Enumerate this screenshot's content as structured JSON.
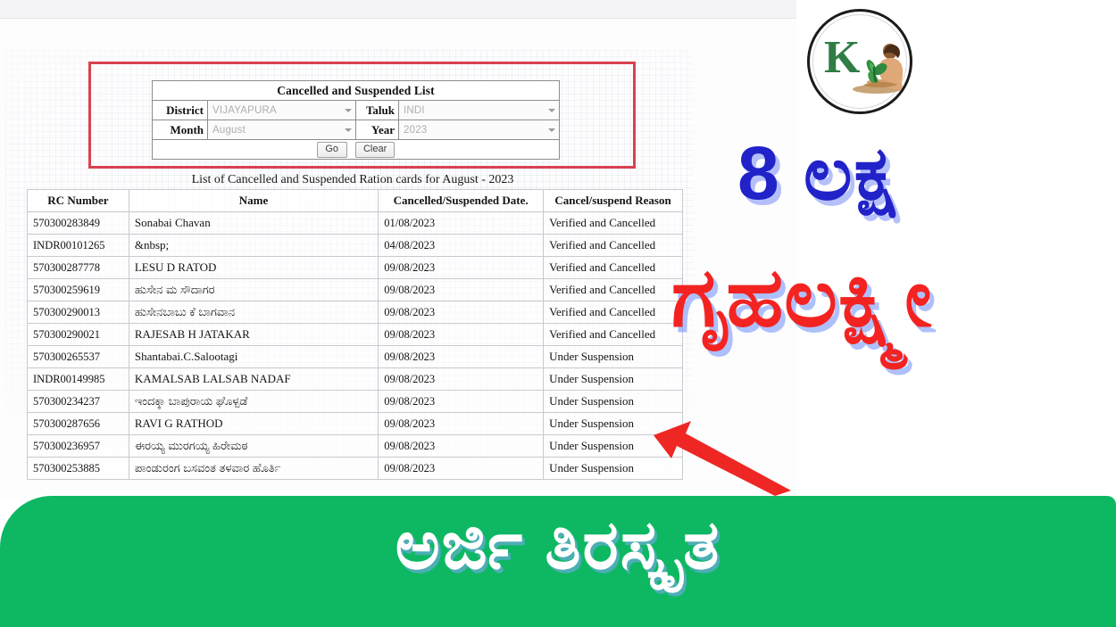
{
  "logo": {
    "letter": "K",
    "icon": "farmer-with-plant-icon"
  },
  "filter_form": {
    "title": "Cancelled and Suspended List",
    "fields": {
      "district_label": "District",
      "district_value": "VIJAYAPURA",
      "taluk_label": "Taluk",
      "taluk_value": "INDI",
      "month_label": "Month",
      "month_value": "August",
      "year_label": "Year",
      "year_value": "2023"
    },
    "buttons": {
      "go": "Go",
      "clear": "Clear"
    }
  },
  "results": {
    "caption": "List of Cancelled and Suspended Ration cards for August - 2023",
    "columns": {
      "rc": "RC Number",
      "name": "Name",
      "date": "Cancelled/Suspended Date.",
      "reason": "Cancel/suspend Reason"
    },
    "rows": [
      {
        "rc": "570300283849",
        "name": "Sonabai Chavan",
        "kannada": false,
        "date": "01/08/2023",
        "reason": "Verified and Cancelled"
      },
      {
        "rc": "INDR00101265",
        "name": "&nbsp;",
        "kannada": false,
        "date": "04/08/2023",
        "reason": "Verified and Cancelled"
      },
      {
        "rc": "570300287778",
        "name": "LESU D RATOD",
        "kannada": false,
        "date": "09/08/2023",
        "reason": "Verified and Cancelled"
      },
      {
        "rc": "570300259619",
        "name": "ಹುಸೇನ ಮ ಸೌದಾಗರ",
        "kannada": true,
        "date": "09/08/2023",
        "reason": "Verified and Cancelled"
      },
      {
        "rc": "570300290013",
        "name": "ಹುಸೇನಬಾಬು ಕೆ ಬಾಗವಾನ",
        "kannada": true,
        "date": "09/08/2023",
        "reason": "Verified and Cancelled"
      },
      {
        "rc": "570300290021",
        "name": "RAJESAB H JATAKAR",
        "kannada": false,
        "date": "09/08/2023",
        "reason": "Verified and Cancelled"
      },
      {
        "rc": "570300265537",
        "name": "Shantabai.C.Salootagi",
        "kannada": false,
        "date": "09/08/2023",
        "reason": "Under Suspension"
      },
      {
        "rc": "INDR00149985",
        "name": "KAMALSAB LALSAB NADAF",
        "kannada": false,
        "date": "09/08/2023",
        "reason": "Under Suspension"
      },
      {
        "rc": "570300234237",
        "name": "ಇಂದಕ್ಕಾ ಬಾಪುರಾಯ ಘೊಳ್ಪಡೆ",
        "kannada": true,
        "date": "09/08/2023",
        "reason": "Under Suspension"
      },
      {
        "rc": "570300287656",
        "name": "RAVI G RATHOD",
        "kannada": false,
        "date": "09/08/2023",
        "reason": "Under Suspension"
      },
      {
        "rc": "570300236957",
        "name": "ಈರಯ್ಯ ಮುರಗಯ್ಯ ಹಿರೇಮಠ",
        "kannada": true,
        "date": "09/08/2023",
        "reason": "Under Suspension"
      },
      {
        "rc": "570300253885",
        "name": "ಪಾಂಡುರಂಗ ಬಸವಂತ ತಳವಾರ ಹೊರ್ತಿ",
        "kannada": true,
        "date": "09/08/2023",
        "reason": "Under Suspension"
      }
    ]
  },
  "overlay": {
    "headline_blue": "8 ಲಕ್ಷ",
    "headline_red": "ಗೃಹಲಕ್ಷ್ಮೀ",
    "arrow": "up-left-arrow-icon"
  },
  "banner": {
    "text": "ಅರ್ಜಿ ತಿರಸ್ಕೃತ"
  },
  "colors": {
    "banner_green": "#0eb863",
    "headline_blue": "#2222c9",
    "headline_red": "#f32321",
    "highlight_red": "#d8414f",
    "logo_green": "#2f7d44"
  }
}
